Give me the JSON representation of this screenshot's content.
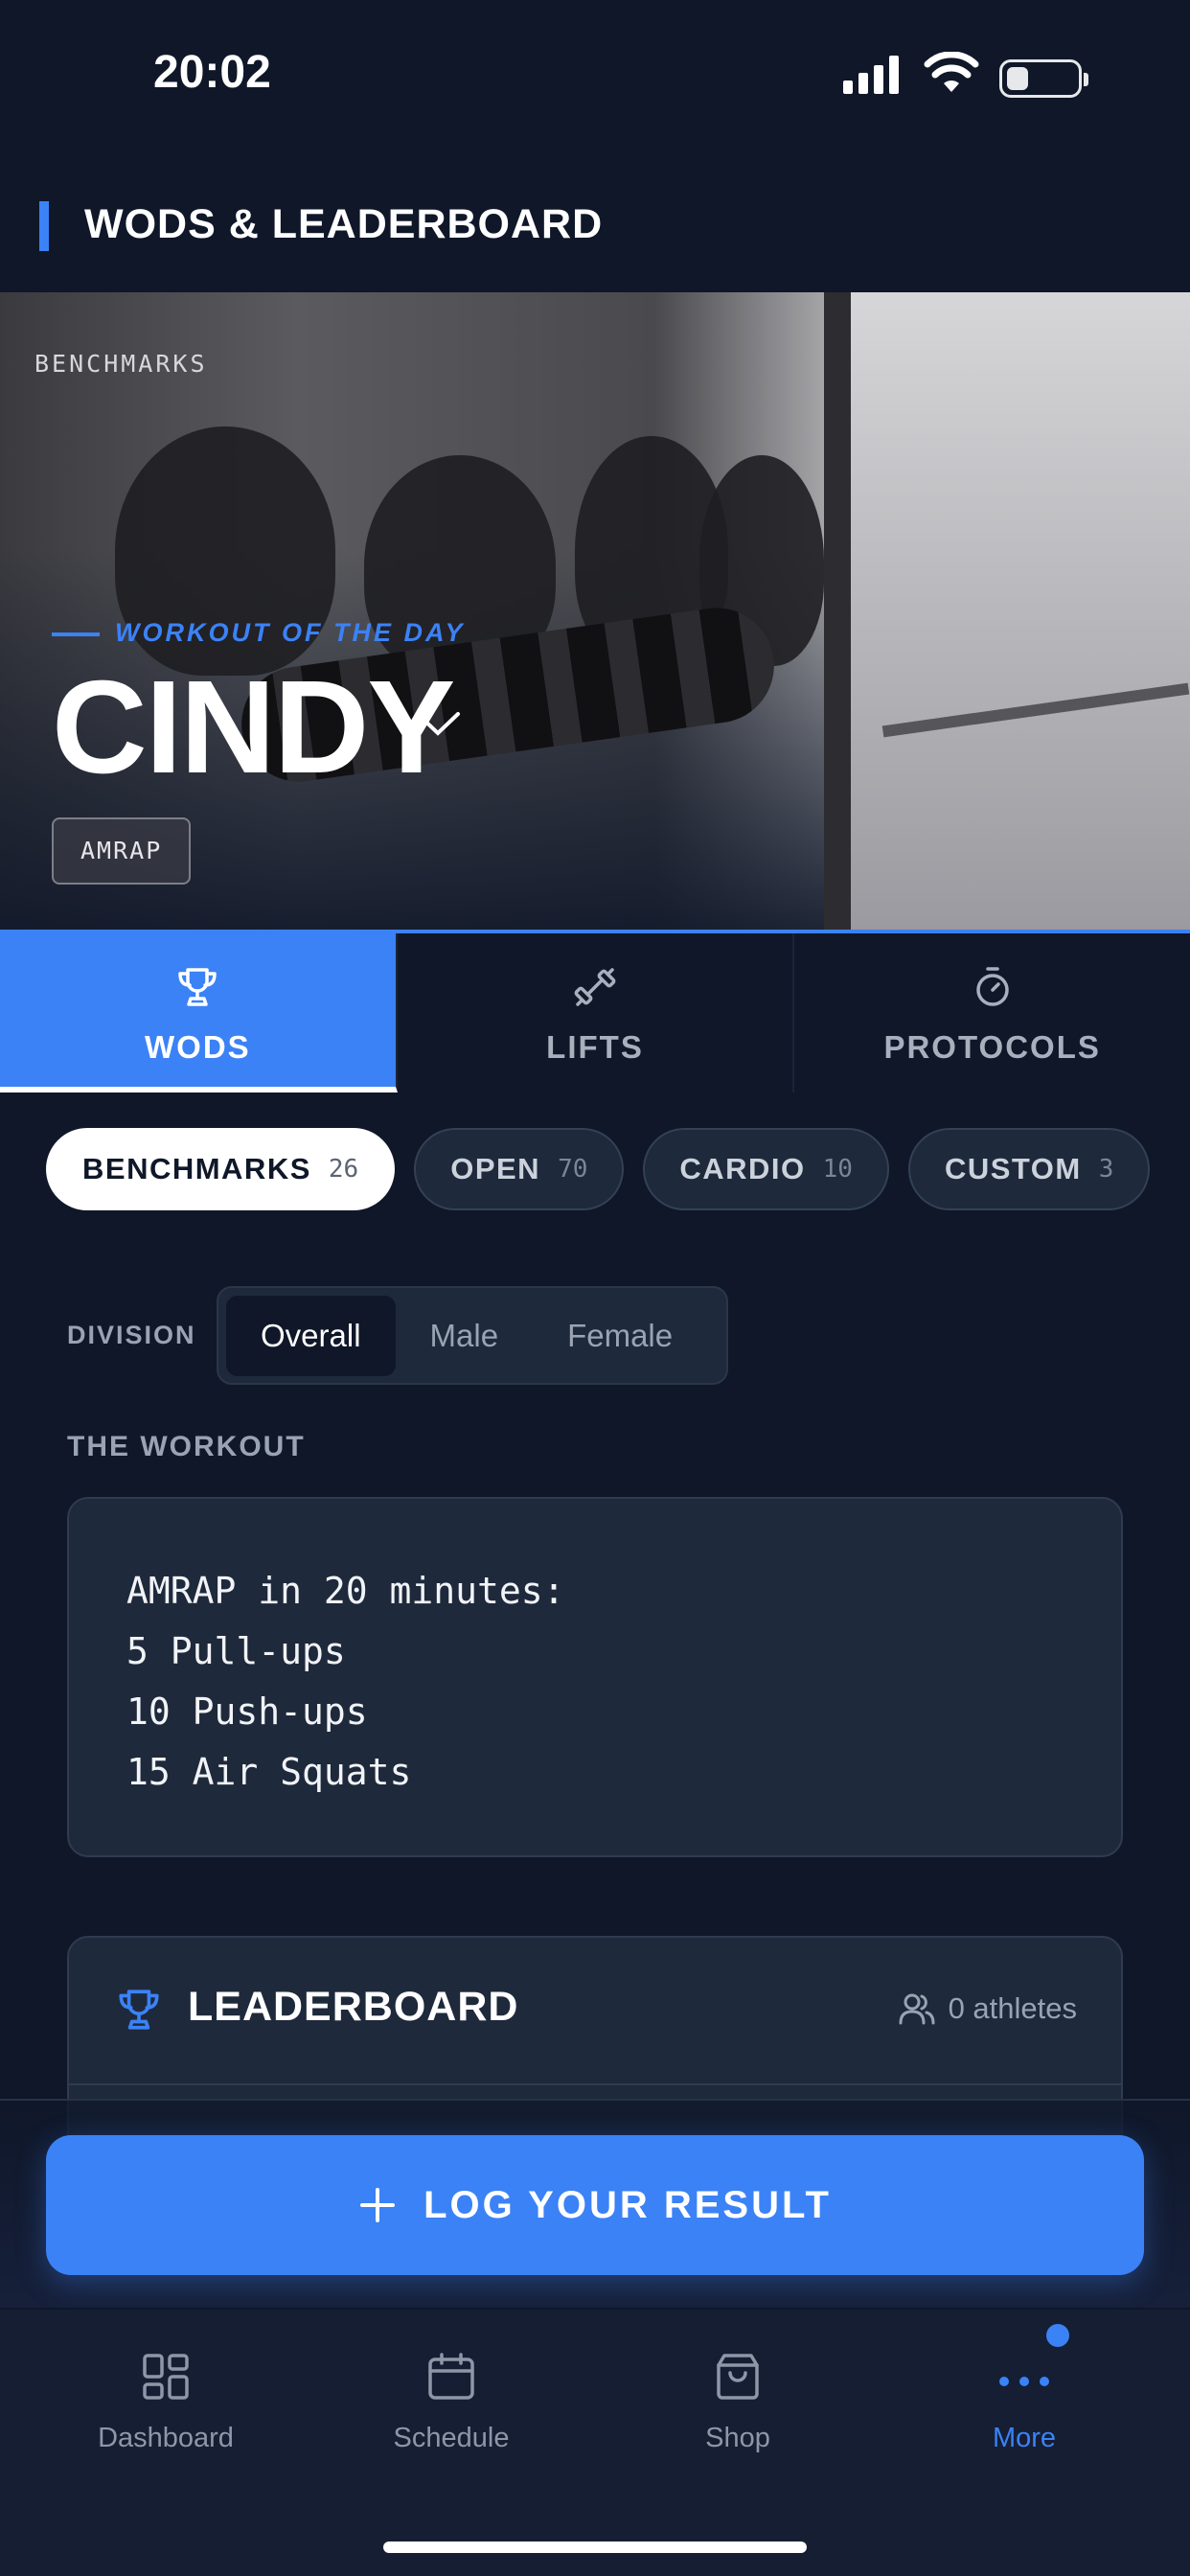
{
  "status_bar": {
    "time": "20:02"
  },
  "header": {
    "title": "WODS & LEADERBOARD"
  },
  "hero": {
    "breadcrumb": "BENCHMARKS",
    "wod_label": "WORKOUT OF THE DAY",
    "title": "CINDY",
    "type_chip": "AMRAP"
  },
  "tabs": [
    {
      "label": "WODS",
      "icon": "trophy-icon",
      "active": true
    },
    {
      "label": "LIFTS",
      "icon": "dumbbell-icon",
      "active": false
    },
    {
      "label": "PROTOCOLS",
      "icon": "stopwatch-icon",
      "active": false
    }
  ],
  "filters": [
    {
      "label": "BENCHMARKS",
      "count": "26",
      "active": true
    },
    {
      "label": "OPEN",
      "count": "70",
      "active": false
    },
    {
      "label": "CARDIO",
      "count": "10",
      "active": false
    },
    {
      "label": "CUSTOM",
      "count": "3",
      "active": false
    }
  ],
  "division": {
    "label": "DIVISION",
    "options": [
      "Overall",
      "Male",
      "Female"
    ],
    "selected": "Overall"
  },
  "workout": {
    "label": "THE WORKOUT",
    "lines": [
      "AMRAP in 20 minutes:",
      "5 Pull-ups",
      "10 Push-ups",
      "15 Air Squats"
    ]
  },
  "leaderboard": {
    "title": "LEADERBOARD",
    "athletes": "0 athletes"
  },
  "cta": {
    "label": "LOG YOUR RESULT"
  },
  "nav": [
    {
      "label": "Dashboard",
      "icon": "dashboard-icon",
      "active": false
    },
    {
      "label": "Schedule",
      "icon": "calendar-icon",
      "active": false
    },
    {
      "label": "Shop",
      "icon": "shopping-bag-icon",
      "active": false
    },
    {
      "label": "More",
      "icon": "more-icon",
      "active": true
    }
  ],
  "colors": {
    "accent": "#3b82f6",
    "background": "#0f1729",
    "card": "#1e293b"
  }
}
